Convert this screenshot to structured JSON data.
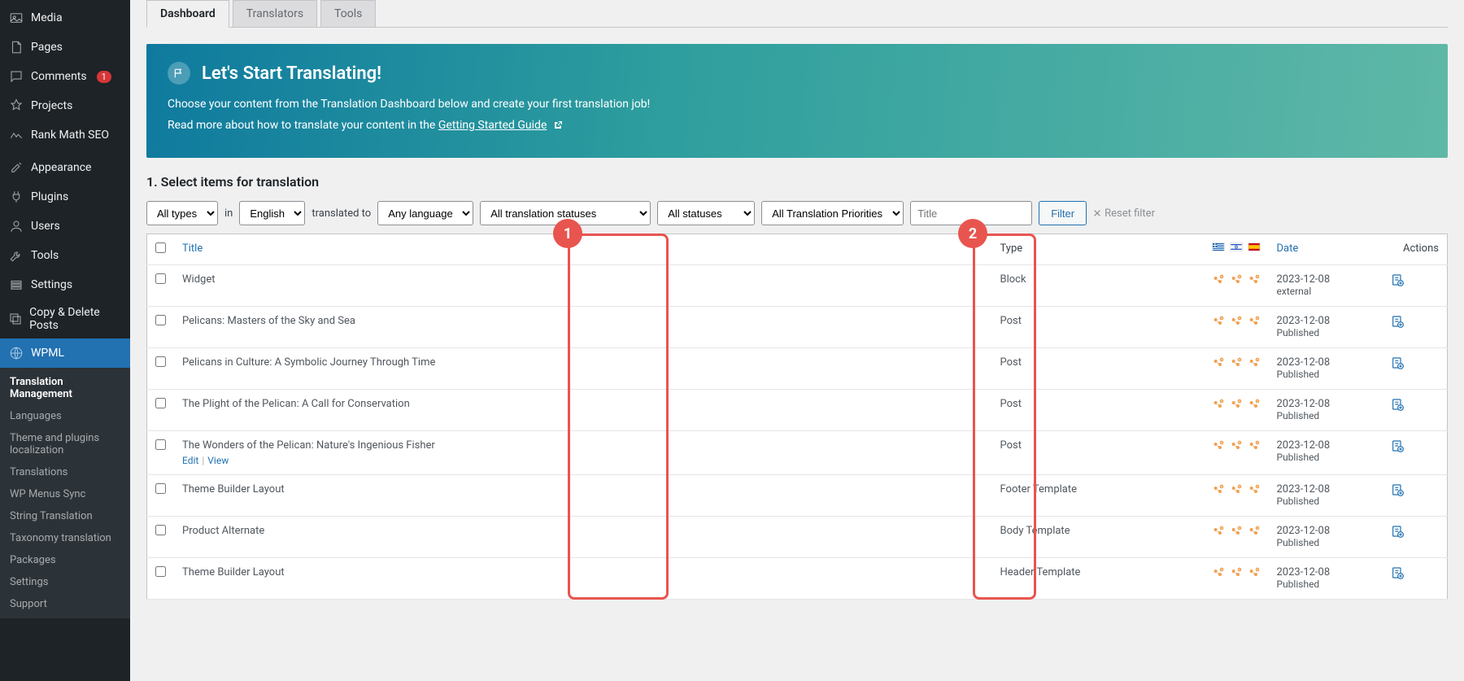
{
  "sidebar": {
    "items": [
      {
        "label": "Media",
        "icon": "media"
      },
      {
        "label": "Pages",
        "icon": "page"
      },
      {
        "label": "Comments",
        "icon": "comment",
        "badge": "1"
      },
      {
        "label": "Projects",
        "icon": "pin"
      },
      {
        "label": "Rank Math SEO",
        "icon": "seo",
        "sep": true
      },
      {
        "label": "Appearance",
        "icon": "brush"
      },
      {
        "label": "Plugins",
        "icon": "plug"
      },
      {
        "label": "Users",
        "icon": "user"
      },
      {
        "label": "Tools",
        "icon": "wrench"
      },
      {
        "label": "Settings",
        "icon": "settings"
      },
      {
        "label": "Copy & Delete Posts",
        "icon": "copy"
      },
      {
        "label": "WPML",
        "icon": "globe",
        "active": true
      }
    ],
    "submenu": [
      {
        "label": "Translation Management",
        "current": true
      },
      {
        "label": "Languages"
      },
      {
        "label": "Theme and plugins localization"
      },
      {
        "label": "Translations"
      },
      {
        "label": "WP Menus Sync"
      },
      {
        "label": "String Translation"
      },
      {
        "label": "Taxonomy translation"
      },
      {
        "label": "Packages"
      },
      {
        "label": "Settings"
      },
      {
        "label": "Support"
      }
    ]
  },
  "tabs": [
    {
      "label": "Dashboard",
      "active": true
    },
    {
      "label": "Translators"
    },
    {
      "label": "Tools"
    }
  ],
  "banner": {
    "title": "Let's Start Translating!",
    "line1": "Choose your content from the Translation Dashboard below and create your first translation job!",
    "line2_prefix": "Read more about how to translate your content in the ",
    "line2_link": "Getting Started Guide"
  },
  "section": {
    "title": "1. Select items for translation"
  },
  "filters": {
    "types": "All types",
    "in": "in",
    "lang": "English",
    "translated_to": "translated to",
    "anylang": "Any language",
    "tstatus": "All translation statuses",
    "status": "All statuses",
    "priority": "All Translation Priorities",
    "title_ph": "Title",
    "filter_btn": "Filter",
    "reset": "Reset filter"
  },
  "columns": {
    "title": "Title",
    "type": "Type",
    "date": "Date",
    "actions": "Actions"
  },
  "rows": [
    {
      "title": "Widget",
      "type": "Block",
      "date": "2023-12-08",
      "status": "external"
    },
    {
      "title": "Pelicans: Masters of the Sky and Sea",
      "type": "Post",
      "date": "2023-12-08",
      "status": "Published"
    },
    {
      "title": "Pelicans in Culture: A Symbolic Journey Through Time",
      "type": "Post",
      "date": "2023-12-08",
      "status": "Published"
    },
    {
      "title": "The Plight of the Pelican: A Call for Conservation",
      "type": "Post",
      "date": "2023-12-08",
      "status": "Published"
    },
    {
      "title": "The Wonders of the Pelican: Nature's Ingenious Fisher",
      "type": "Post",
      "date": "2023-12-08",
      "status": "Published",
      "actions": true
    },
    {
      "title": "Theme Builder Layout",
      "type": "Footer Template",
      "date": "2023-12-08",
      "status": "Published"
    },
    {
      "title": "Product Alternate",
      "type": "Body Template",
      "date": "2023-12-08",
      "status": "Published"
    },
    {
      "title": "Theme Builder Layout",
      "type": "Header Template",
      "date": "2023-12-08",
      "status": "Published"
    }
  ],
  "row_actions": {
    "edit": "Edit",
    "view": "View"
  },
  "flags": [
    "greece",
    "israel",
    "spain"
  ],
  "annotations": {
    "one": "1",
    "two": "2"
  }
}
